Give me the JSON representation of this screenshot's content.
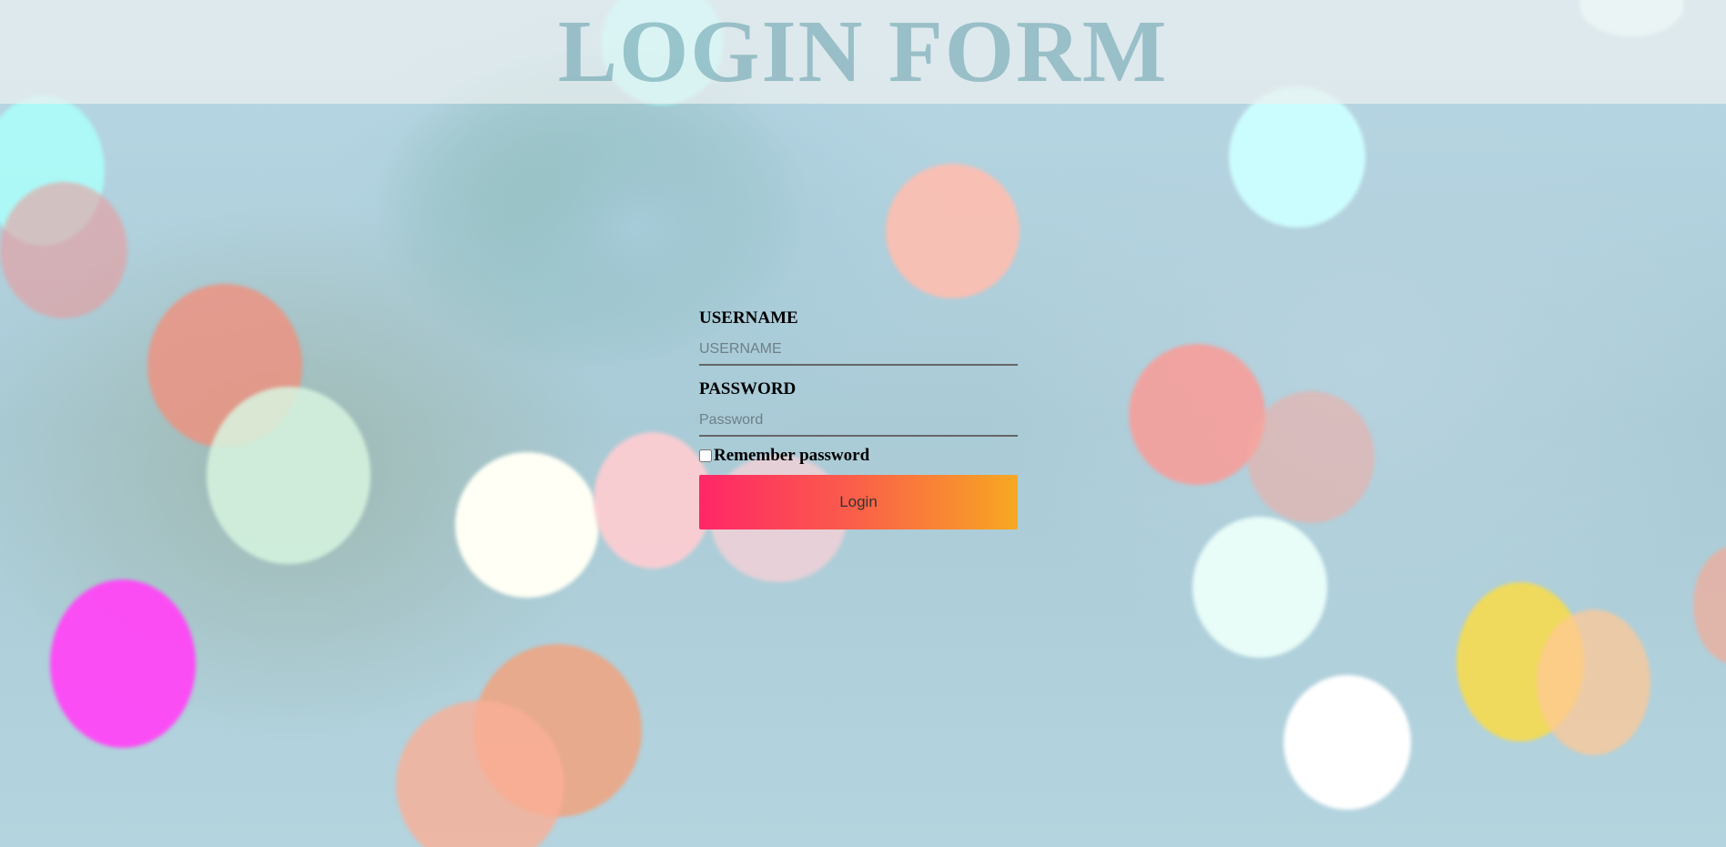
{
  "header": {
    "title": "LOGIN FORM"
  },
  "form": {
    "username_label": "USERNAME",
    "username_placeholder": "USERNAME",
    "username_value": "",
    "password_label": "PASSWORD",
    "password_placeholder": "Password",
    "password_value": "",
    "remember_label": "Remember password",
    "remember_checked": false,
    "login_label": "Login"
  },
  "colors": {
    "button_gradient_start": "#ff2668",
    "button_gradient_end": "#f7a822",
    "title_color": "#468c9b"
  }
}
